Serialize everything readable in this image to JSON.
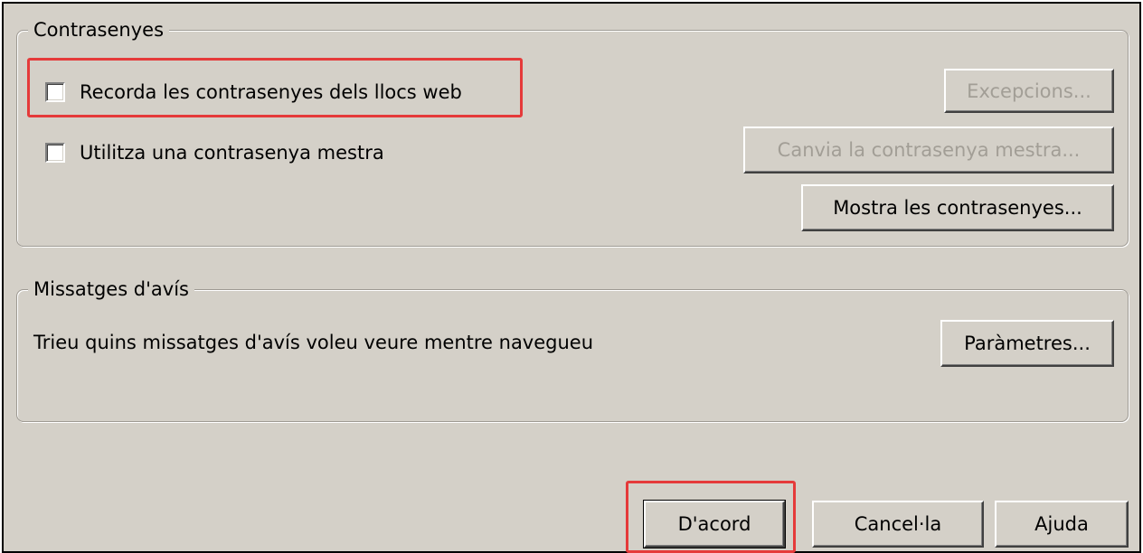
{
  "passwords": {
    "legend": "Contrasenyes",
    "remember_checkbox": {
      "label": "Recorda les contrasenyes dels llocs web",
      "checked": false
    },
    "master_checkbox": {
      "label": "Utilitza una contrasenya mestra",
      "checked": false
    },
    "exceptions_button": {
      "label": "Excepcions...",
      "enabled": false
    },
    "change_master_button": {
      "label": "Canvia la contrasenya mestra...",
      "enabled": false
    },
    "show_passwords_button": {
      "label": "Mostra les contrasenyes...",
      "enabled": true
    }
  },
  "warnings": {
    "legend": "Missatges d'avís",
    "description": "Trieu quins missatges d'avís voleu veure mentre navegueu",
    "settings_button": {
      "label": "Paràmetres..."
    }
  },
  "footer": {
    "ok_label": "D'acord",
    "cancel_label": "Cancel·la",
    "help_label": "Ajuda"
  },
  "colors": {
    "dialog_background": "#d4d0c8",
    "highlight": "#e53a3a",
    "disabled_text": "#a29e96"
  }
}
